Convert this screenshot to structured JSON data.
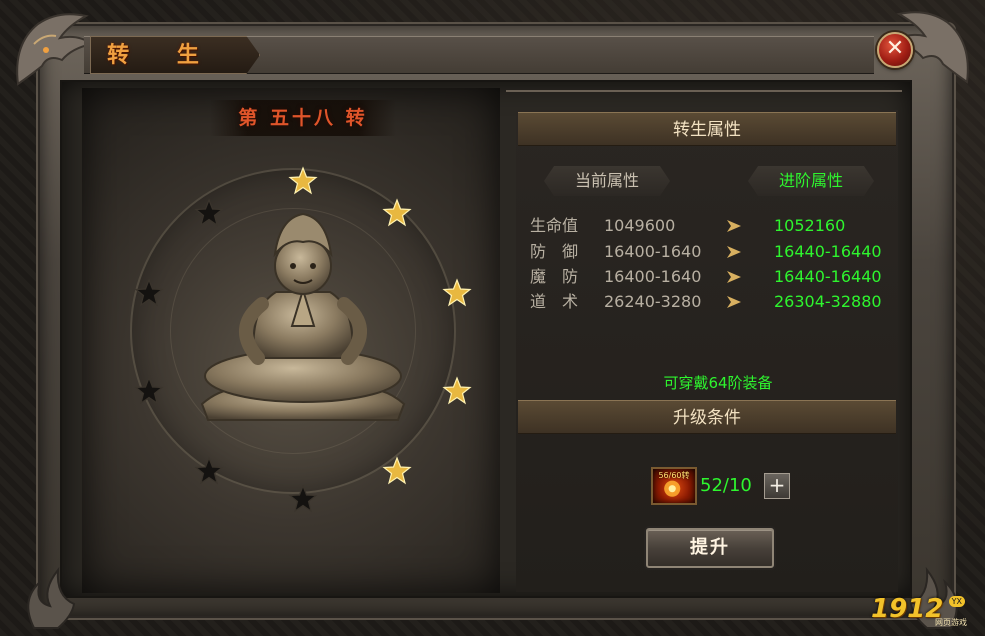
{
  "window": {
    "title": "转 生",
    "close_icon": "close-icon"
  },
  "left": {
    "rebirth_level": "第 五十八 转",
    "stars": [
      {
        "filled": true
      },
      {
        "filled": true
      },
      {
        "filled": true
      },
      {
        "filled": true
      },
      {
        "filled": true
      },
      {
        "filled": false
      },
      {
        "filled": false
      },
      {
        "filled": false
      },
      {
        "filled": false
      },
      {
        "filled": false
      }
    ]
  },
  "right": {
    "section_attrs": "转生属性",
    "tab_current": "当前属性",
    "tab_next": "进阶属性",
    "attributes": [
      {
        "name": "生命值",
        "current": "1049600",
        "next": "1052160"
      },
      {
        "name": "防　御",
        "current": "16400-1640",
        "next": "16440-16440"
      },
      {
        "name": "魔　防",
        "current": "16400-1640",
        "next": "16440-16440"
      },
      {
        "name": "道　术",
        "current": "26240-3280",
        "next": "26304-32880"
      }
    ],
    "equip_note": "可穿戴64阶装备",
    "section_cond": "升级条件",
    "item_badge": "56/60转",
    "item_count": "52/10",
    "plus_label": "+",
    "upgrade_label": "提升"
  },
  "logo": {
    "text": "1912",
    "yx": "YX",
    "sub": "网页游戏"
  },
  "colors": {
    "accent_green": "#2ef52e",
    "title_orange": "#f0a040",
    "star_gold": "#e8b840",
    "star_dark": "#141210"
  }
}
